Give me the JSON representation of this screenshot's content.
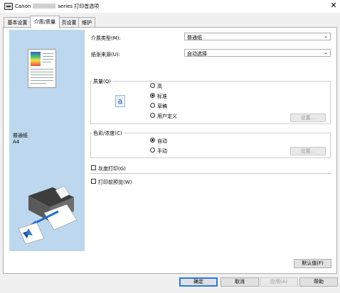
{
  "window": {
    "title_prefix": "Canon",
    "title_suffix": "series 打印首选项",
    "close_glyph": "✕"
  },
  "tabs": [
    {
      "label": "基本设置",
      "active": false
    },
    {
      "label": "介质/质量",
      "active": true
    },
    {
      "label": "页设置",
      "active": false
    },
    {
      "label": "维护",
      "active": false
    }
  ],
  "preview": {
    "media_name": "普通纸",
    "media_size": "A4"
  },
  "media_type": {
    "label": "介质类型(M):",
    "value": "普通纸"
  },
  "paper_source": {
    "label": "纸张来源(U):",
    "value": "自动选择"
  },
  "quality": {
    "title": "质量(Q)",
    "icon_glyph": "a",
    "options": [
      {
        "label": "高",
        "selected": false
      },
      {
        "label": "标准",
        "selected": true
      },
      {
        "label": "草稿",
        "selected": false
      },
      {
        "label": "用户定义",
        "selected": false
      }
    ],
    "settings_button": "设置..."
  },
  "color": {
    "title": "色彩/浓度(C)",
    "options": [
      {
        "label": "自动",
        "selected": true
      },
      {
        "label": "手动",
        "selected": false
      }
    ],
    "settings_button": "设置..."
  },
  "grayscale": {
    "label": "灰度打印(G)",
    "checked": false
  },
  "print_preview": {
    "label": "打印前预览(W)",
    "checked": false
  },
  "defaults_button": "默认值(F)",
  "footer": {
    "ok": "确定",
    "cancel": "取消",
    "apply": "应用(A)",
    "help": "帮助"
  },
  "icons": {
    "app": "printer-app-icon",
    "close": "close-icon",
    "chevron": "chevron-down-icon",
    "quality": "quality-letter-icon"
  },
  "colors": {
    "preview_bg": "#bdd7ee",
    "primary_border": "#2a7be4",
    "panel_bg": "#ffffff",
    "window_bg": "#f0f0f0"
  }
}
